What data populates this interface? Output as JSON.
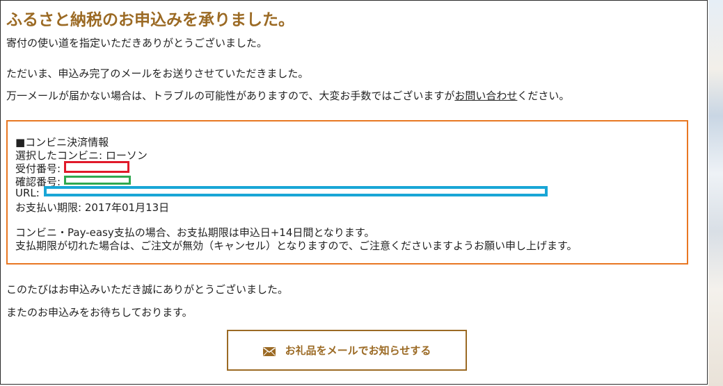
{
  "header": {
    "title": "ふるさと納税のお申込みを承りました。"
  },
  "messages": {
    "line1": "寄付の使い道を指定いただきありがとうございました。",
    "line2": "ただいま、申込み完了のメールをお送りさせていただきました。",
    "line3_before": "万一メールが届かない場合は、トラブルの可能性がありますので、大変お手数ではございますが",
    "line3_link": "お問い合わせ",
    "line3_after": "ください。"
  },
  "payment_info": {
    "heading": "■コンビニ決済情報",
    "store_label": "選択したコンビニ: ローソン",
    "receipt_label": "受付番号:",
    "confirm_label": "確認番号:",
    "url_label": "URL:",
    "deadline": "お支払い期限: 2017年01月13日",
    "note1": "コンビニ・Pay-easy支払の場合、お支払期限は申込日+14日間となります。",
    "note2": "支払期限が切れた場合は、ご注文が無効（キャンセル）となりますので、ご注意くださいますようお願い申し上げます。"
  },
  "closing": {
    "line1": "このたびはお申込みいただき誠にありがとうございました。",
    "line2": "またのお申込みをお待ちしております。"
  },
  "mail_button": {
    "label": "お礼品をメールでお知らせする",
    "icon": "envelope-icon"
  },
  "colors": {
    "accent_brown": "#9b6a24",
    "box_border_orange": "#e87722",
    "redact_red": "#e01a2a",
    "redact_green": "#2fa84f",
    "redact_blue": "#19a6d6"
  }
}
